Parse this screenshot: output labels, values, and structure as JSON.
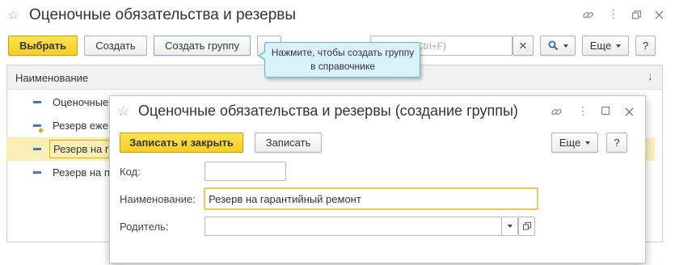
{
  "main": {
    "title": "Оценочные обязательства и резервы",
    "toolbar": {
      "select_label": "Выбрать",
      "create_label": "Создать",
      "create_group_label": "Создать группу",
      "search_placeholder": "(Ctrl+F)",
      "more_label": "Еще",
      "help_label": "?"
    },
    "tooltip": "Нажмите, чтобы создать группу в справочнике",
    "table": {
      "column_header": "Наименование",
      "rows": [
        {
          "label": "Оценочные"
        },
        {
          "label": "Резерв еже"
        },
        {
          "label": "Резерв на г"
        },
        {
          "label": "Резерв на п"
        }
      ]
    }
  },
  "dialog": {
    "title": "Оценочные обязательства и резервы (создание группы)",
    "save_close_label": "Записать и закрыть",
    "save_label": "Записать",
    "more_label": "Еще",
    "help_label": "?",
    "code_label": "Код:",
    "code_value": "",
    "name_label": "Наименование:",
    "name_value": "Резерв на гарантийный ремонт",
    "parent_label": "Родитель:",
    "parent_value": ""
  },
  "colors": {
    "accent_yellow": "#f5ce1f",
    "selected_row": "#fbefb8",
    "tooltip_bg": "#d8f1fa",
    "tooltip_border": "#58b7d8",
    "row_icon": "#4a76b8"
  }
}
